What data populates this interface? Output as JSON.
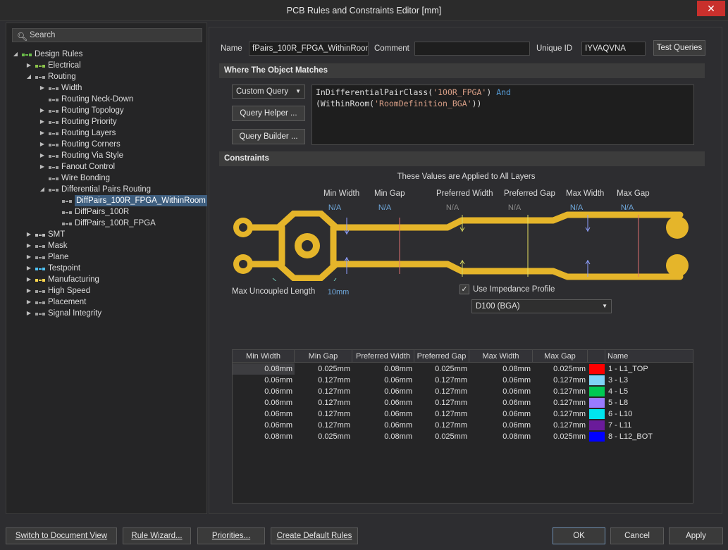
{
  "window": {
    "title": "PCB Rules and Constraints Editor [mm]",
    "close_glyph": "✕"
  },
  "search": {
    "label": "Search"
  },
  "tree": [
    {
      "label": "Design Rules",
      "level": 0,
      "expanded": true,
      "icon": "rules-folder-icon"
    },
    {
      "label": "Electrical",
      "level": 1,
      "expanded": false,
      "icon": "electrical-icon"
    },
    {
      "label": "Routing",
      "level": 1,
      "expanded": true,
      "icon": "routing-icon"
    },
    {
      "label": "Width",
      "level": 2,
      "expanded": false,
      "icon": "rule-icon"
    },
    {
      "label": "Routing Neck-Down",
      "level": 2,
      "expanded": null,
      "icon": "rule-icon"
    },
    {
      "label": "Routing Topology",
      "level": 2,
      "expanded": false,
      "icon": "rule-icon"
    },
    {
      "label": "Routing Priority",
      "level": 2,
      "expanded": false,
      "icon": "rule-icon"
    },
    {
      "label": "Routing Layers",
      "level": 2,
      "expanded": false,
      "icon": "rule-icon"
    },
    {
      "label": "Routing Corners",
      "level": 2,
      "expanded": false,
      "icon": "rule-icon"
    },
    {
      "label": "Routing Via Style",
      "level": 2,
      "expanded": false,
      "icon": "rule-icon"
    },
    {
      "label": "Fanout Control",
      "level": 2,
      "expanded": false,
      "icon": "rule-icon"
    },
    {
      "label": "Wire Bonding",
      "level": 2,
      "expanded": null,
      "icon": "rule-icon"
    },
    {
      "label": "Differential Pairs Routing",
      "level": 2,
      "expanded": true,
      "icon": "rule-icon"
    },
    {
      "label": "DiffPairs_100R_FPGA_WithinRoom",
      "level": 3,
      "expanded": null,
      "icon": "rule-icon",
      "selected": true
    },
    {
      "label": "DiffPairs_100R",
      "level": 3,
      "expanded": null,
      "icon": "rule-icon"
    },
    {
      "label": "DiffPairs_100R_FPGA",
      "level": 3,
      "expanded": null,
      "icon": "rule-icon"
    },
    {
      "label": "SMT",
      "level": 1,
      "expanded": false,
      "icon": "smt-icon"
    },
    {
      "label": "Mask",
      "level": 1,
      "expanded": false,
      "icon": "mask-icon"
    },
    {
      "label": "Plane",
      "level": 1,
      "expanded": false,
      "icon": "plane-icon"
    },
    {
      "label": "Testpoint",
      "level": 1,
      "expanded": false,
      "icon": "testpoint-icon"
    },
    {
      "label": "Manufacturing",
      "level": 1,
      "expanded": false,
      "icon": "manufacturing-icon"
    },
    {
      "label": "High Speed",
      "level": 1,
      "expanded": false,
      "icon": "high-speed-icon"
    },
    {
      "label": "Placement",
      "level": 1,
      "expanded": false,
      "icon": "placement-icon"
    },
    {
      "label": "Signal Integrity",
      "level": 1,
      "expanded": false,
      "icon": "signal-integrity-icon"
    }
  ],
  "rule": {
    "name_label": "Name",
    "name_value": "fPairs_100R_FPGA_WithinRoom",
    "comment_label": "Comment",
    "comment_value": "",
    "uid_label": "Unique ID",
    "uid_value": "IYVAQVNA",
    "test_queries": "Test Queries"
  },
  "where": {
    "section_title": "Where The Object Matches",
    "query_type": "Custom Query",
    "query_helper": "Query Helper ...",
    "query_builder": "Query Builder ...",
    "query_parts": {
      "p1": "InDifferentialPairClass(",
      "s1": "'100R_FPGA'",
      "p2": ") ",
      "kw": "And",
      "p3": "(WithinRoom(",
      "s2": "'RoomDefinition_BGA'",
      "p4": "))"
    }
  },
  "constraints": {
    "section_title": "Constraints",
    "applied_note": "These Values are Applied to All Layers",
    "min_width_label": "Min Width",
    "min_gap_label": "Min Gap",
    "pref_width_label": "Preferred Width",
    "pref_gap_label": "Preferred Gap",
    "max_width_label": "Max Width",
    "max_gap_label": "Max Gap",
    "min_width_val": "N/A",
    "min_gap_val": "N/A",
    "pref_width_val": "N/A",
    "pref_gap_val": "N/A",
    "max_width_val": "N/A",
    "max_gap_val": "N/A",
    "max_uncoupled_label": "Max Uncoupled Length",
    "max_uncoupled_val": "10mm",
    "use_impedance_label": "Use Impedance Profile",
    "use_impedance_checked": true,
    "impedance_profile": "D100 (BGA)",
    "trace_color": "#e5b52a"
  },
  "layer_table": {
    "headers": [
      "Min Width",
      "Min Gap",
      "Preferred Width",
      "Preferred Gap",
      "Max Width",
      "Max Gap",
      "",
      "Name"
    ],
    "rows": [
      {
        "min_width": "0.08mm",
        "min_gap": "0.025mm",
        "pref_width": "0.08mm",
        "pref_gap": "0.025mm",
        "max_width": "0.08mm",
        "max_gap": "0.025mm",
        "color": "#ff0000",
        "name": "1 - L1_TOP"
      },
      {
        "min_width": "0.06mm",
        "min_gap": "0.127mm",
        "pref_width": "0.06mm",
        "pref_gap": "0.127mm",
        "max_width": "0.06mm",
        "max_gap": "0.127mm",
        "color": "#7fd3f7",
        "name": "3 - L3"
      },
      {
        "min_width": "0.06mm",
        "min_gap": "0.127mm",
        "pref_width": "0.06mm",
        "pref_gap": "0.127mm",
        "max_width": "0.06mm",
        "max_gap": "0.127mm",
        "color": "#00c853",
        "name": "4 - L5"
      },
      {
        "min_width": "0.06mm",
        "min_gap": "0.127mm",
        "pref_width": "0.06mm",
        "pref_gap": "0.127mm",
        "max_width": "0.06mm",
        "max_gap": "0.127mm",
        "color": "#9a7bff",
        "name": "5 - L8"
      },
      {
        "min_width": "0.06mm",
        "min_gap": "0.127mm",
        "pref_width": "0.06mm",
        "pref_gap": "0.127mm",
        "max_width": "0.06mm",
        "max_gap": "0.127mm",
        "color": "#00e5ee",
        "name": "6 - L10"
      },
      {
        "min_width": "0.06mm",
        "min_gap": "0.127mm",
        "pref_width": "0.06mm",
        "pref_gap": "0.127mm",
        "max_width": "0.06mm",
        "max_gap": "0.127mm",
        "color": "#6a1b9a",
        "name": "7 - L11"
      },
      {
        "min_width": "0.08mm",
        "min_gap": "0.025mm",
        "pref_width": "0.08mm",
        "pref_gap": "0.025mm",
        "max_width": "0.08mm",
        "max_gap": "0.025mm",
        "color": "#0000ff",
        "name": "8 - L12_BOT"
      }
    ]
  },
  "footer": {
    "switch_view": "Switch to Document View",
    "rule_wizard": "Rule Wizard...",
    "priorities": "Priorities...",
    "create_default": "Create Default Rules",
    "ok": "OK",
    "cancel": "Cancel",
    "apply": "Apply"
  }
}
